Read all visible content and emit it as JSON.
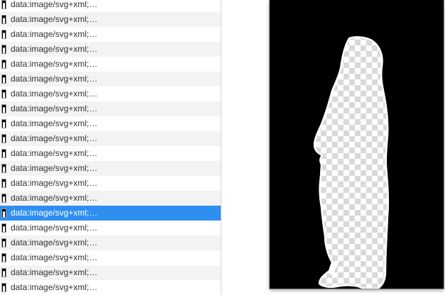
{
  "resource_list": {
    "item_label": "data:image/svg+xml;…",
    "selected_index": 14,
    "thumbnail_icon": "silhouette-thumbnail-icon",
    "items": [
      {
        "label": "data:image/svg+xml;…"
      },
      {
        "label": "data:image/svg+xml;…"
      },
      {
        "label": "data:image/svg+xml;…"
      },
      {
        "label": "data:image/svg+xml;…"
      },
      {
        "label": "data:image/svg+xml;…"
      },
      {
        "label": "data:image/svg+xml;…"
      },
      {
        "label": "data:image/svg+xml;…"
      },
      {
        "label": "data:image/svg+xml;…"
      },
      {
        "label": "data:image/svg+xml;…"
      },
      {
        "label": "data:image/svg+xml;…"
      },
      {
        "label": "data:image/svg+xml;…"
      },
      {
        "label": "data:image/svg+xml;…"
      },
      {
        "label": "data:image/svg+xml;…"
      },
      {
        "label": "data:image/svg+xml;…"
      },
      {
        "label": "data:image/svg+xml;…"
      },
      {
        "label": "data:image/svg+xml;…"
      },
      {
        "label": "data:image/svg+xml;…"
      },
      {
        "label": "data:image/svg+xml;…"
      },
      {
        "label": "data:image/svg+xml;…"
      },
      {
        "label": "data:image/svg+xml;…"
      }
    ]
  },
  "preview": {
    "background_color": "#000000",
    "checker_light": "#ffffff",
    "checker_dark": "#d9d9d9",
    "selection_color": "#2e8ff0"
  }
}
